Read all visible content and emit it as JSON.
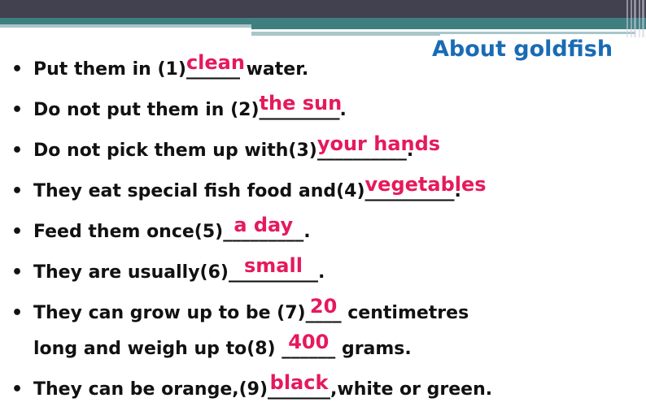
{
  "title": "About goldfish",
  "colors": {
    "header_dark": "#41414f",
    "header_teal": "#3f7f80",
    "header_light": "#a9c6c9",
    "title": "#1a6bb5",
    "answer": "#e6195c",
    "text": "#111111"
  },
  "bullet_symbol": "•",
  "items": [
    {
      "before": "Put them in (1)",
      "blank": "______",
      "answer": "clean",
      "after": " water."
    },
    {
      "before": "Do not put them in (2)",
      "blank": "_________",
      "answer": "the sun",
      "after": "."
    },
    {
      "before": "Do not pick them up with(3)",
      "blank": "__________",
      "answer": "your hands",
      "after": "."
    },
    {
      "before": "They eat special fish food and(4)",
      "blank": "__________",
      "answer": "vegetables",
      "after": "."
    },
    {
      "before": "Feed them once(5)",
      "blank": "_________",
      "answer": "a day",
      "after": "."
    },
    {
      "before": "They are usually(6)",
      "blank": "__________",
      "answer": "small",
      "after": "."
    },
    {
      "before": "They can grow up to be (7)",
      "blank": "____",
      "answer": "20",
      "after": " centimetres",
      "line2": {
        "before": "long and weigh up to(8) ",
        "blank": "______",
        "answer": "400",
        "after": " grams."
      }
    },
    {
      "before": "They can be orange,(9)",
      "blank": "_______",
      "answer": "black",
      "after": ",white or green."
    }
  ]
}
